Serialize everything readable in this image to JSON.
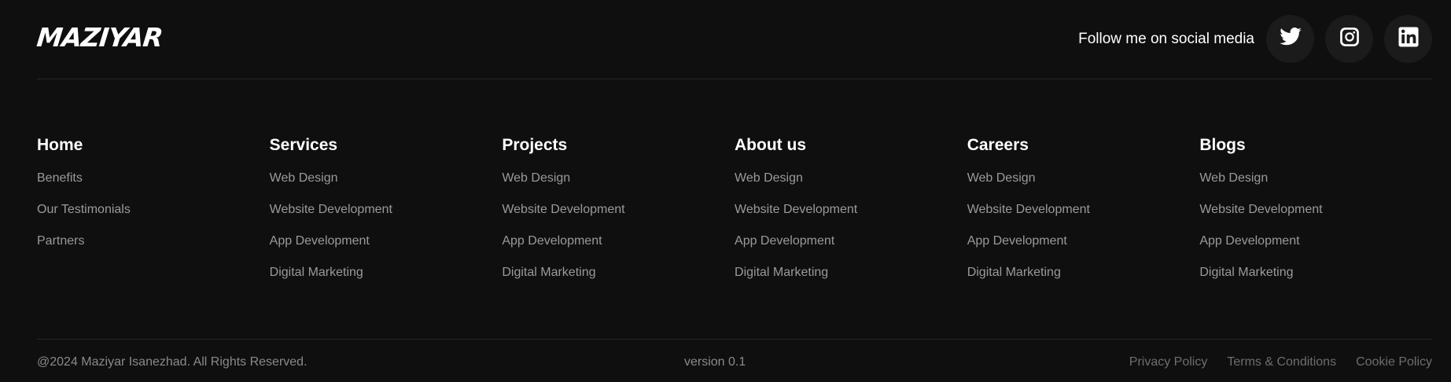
{
  "brand": {
    "logo_text": "MAZIYAR"
  },
  "social": {
    "label": "Follow me on social media",
    "items": [
      {
        "name": "Twitter",
        "icon": "twitter-icon"
      },
      {
        "name": "Instagram",
        "icon": "instagram-icon"
      },
      {
        "name": "LinkedIn",
        "icon": "linkedin-icon"
      }
    ]
  },
  "columns": [
    {
      "title": "Home",
      "links": [
        "Benefits",
        "Our Testimonials",
        "Partners"
      ]
    },
    {
      "title": "Services",
      "links": [
        "Web Design",
        "Website Development",
        "App Development",
        "Digital Marketing"
      ]
    },
    {
      "title": "Projects",
      "links": [
        "Web Design",
        "Website Development",
        "App Development",
        "Digital Marketing"
      ]
    },
    {
      "title": "About us",
      "links": [
        "Web Design",
        "Website Development",
        "App Development",
        "Digital Marketing"
      ]
    },
    {
      "title": "Careers",
      "links": [
        "Web Design",
        "Website Development",
        "App Development",
        "Digital Marketing"
      ]
    },
    {
      "title": "Blogs",
      "links": [
        "Web Design",
        "Website Development",
        "App Development",
        "Digital Marketing"
      ]
    }
  ],
  "bottom": {
    "copyright": "@2024 Maziyar Isanezhad. All Rights Reserved.",
    "version": "version 0.1",
    "legal_links": [
      "Privacy Policy",
      "Terms & Conditions",
      "Cookie Policy"
    ]
  },
  "colors": {
    "background": "#0f0f0f",
    "text_primary": "#ffffff",
    "text_muted": "#9a9a9a",
    "divider": "#262626",
    "social_button_bg": "#1b1b1b"
  }
}
